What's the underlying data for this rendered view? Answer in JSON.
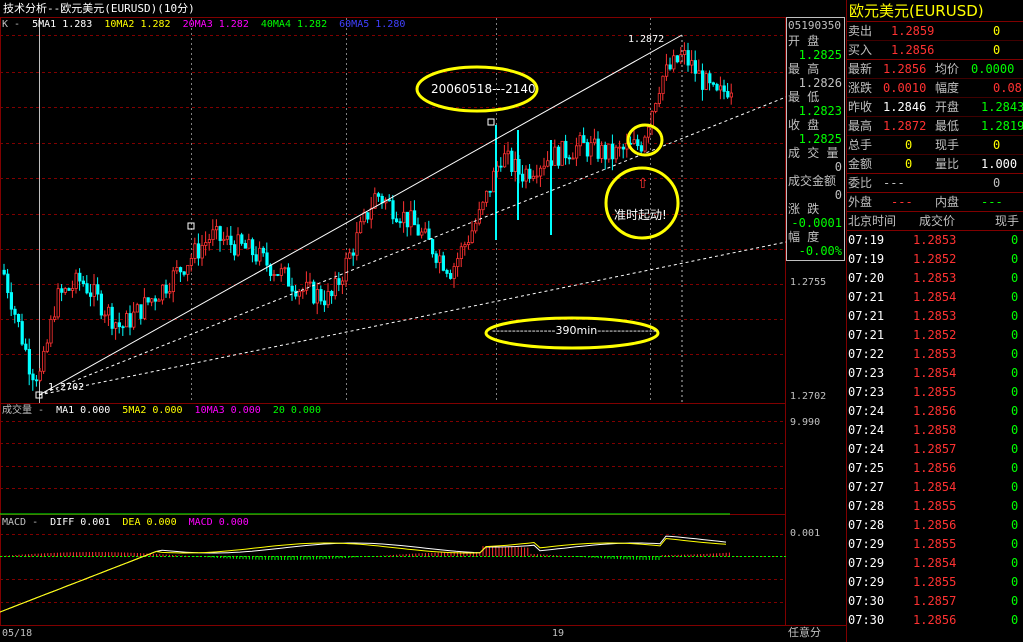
{
  "window": {
    "title": "技术分析--欧元美元(EURUSD)(10分)"
  },
  "indicators": {
    "main": {
      "prefix": "K -",
      "ma1": "5MA1  1.283",
      "ma2": "10MA2  1.282",
      "ma3": "20MA3  1.282",
      "ma4": "40MA4  1.282",
      "ma5": "60MA5  1.280"
    },
    "volume": {
      "prefix": "成交量 -",
      "ma1": "MA1  0.000",
      "ma2": "5MA2  0.000",
      "ma3": "10MA3  0.000",
      "ma4": "20  0.000"
    },
    "macd": {
      "prefix": "MACD -",
      "diff": "DIFF  0.001",
      "dea": "DEA  0.000",
      "macd": "MACD  0.000"
    }
  },
  "price_axis": {
    "p1": "1.2755",
    "p2": "1.2702",
    "vol": "9.990",
    "macd": "0.001"
  },
  "chart_labels": {
    "high": "1.2872",
    "low": "1.2702"
  },
  "time_axis": {
    "start": "05/18",
    "mid": "19",
    "mode": "任意分"
  },
  "annotations": {
    "a1": "20060518---2140",
    "a2": "----------------390min---------------",
    "a3": "准时起动!"
  },
  "crosshair_box": {
    "date": "05190350",
    "open_label": "开    盘",
    "open_value": "1.2825",
    "high_label": "最    高",
    "high_value": "1.2826",
    "low_label": "最    低",
    "low_value": "1.2823",
    "close_label": "收    盘",
    "close_value": "1.2825",
    "vol_label": "成 交 量",
    "vol_value": "0",
    "amount_label": "成交金额",
    "amount_value": "0",
    "change_label": "涨    跌",
    "change_value": "-0.0001",
    "pct_label": "幅    度",
    "pct_value": "-0.00%"
  },
  "quote": {
    "title": "欧元美元(EURUSD)",
    "sell": {
      "label": "卖出",
      "price": "1.2859",
      "vol": "0"
    },
    "buy": {
      "label": "买入",
      "price": "1.2856",
      "vol": "0"
    },
    "latest": {
      "label": "最新",
      "value": "1.2856",
      "label2": "均价",
      "value2": "0.0000"
    },
    "change": {
      "label": "涨跌",
      "value": "0.0010",
      "label2": "幅度",
      "value2": "0.08"
    },
    "prev": {
      "label": "昨收",
      "value": "1.2846",
      "label2": "开盘",
      "value2": "1.2843"
    },
    "high": {
      "label": "最高",
      "value": "1.2872",
      "label2": "最低",
      "value2": "1.2819"
    },
    "total": {
      "label": "总手",
      "value": "0",
      "label2": "现手",
      "value2": "0"
    },
    "amount": {
      "label": "金额",
      "value": "0",
      "label2": "量比",
      "value2": "1.000"
    },
    "ratio": {
      "label": "委比",
      "value": "---",
      "value2": "0"
    },
    "outer": {
      "label": "外盘",
      "value": "---",
      "label2": "内盘",
      "value2": "---"
    },
    "ticks_header": {
      "time": "北京时间",
      "price": "成交价",
      "vol": "现手"
    },
    "ticks": [
      {
        "t": "07:19",
        "p": "1.2853",
        "v": "0"
      },
      {
        "t": "07:19",
        "p": "1.2852",
        "v": "0"
      },
      {
        "t": "07:20",
        "p": "1.2853",
        "v": "0"
      },
      {
        "t": "07:21",
        "p": "1.2854",
        "v": "0"
      },
      {
        "t": "07:21",
        "p": "1.2853",
        "v": "0"
      },
      {
        "t": "07:21",
        "p": "1.2852",
        "v": "0"
      },
      {
        "t": "07:22",
        "p": "1.2853",
        "v": "0"
      },
      {
        "t": "07:23",
        "p": "1.2854",
        "v": "0"
      },
      {
        "t": "07:23",
        "p": "1.2855",
        "v": "0"
      },
      {
        "t": "07:24",
        "p": "1.2856",
        "v": "0"
      },
      {
        "t": "07:24",
        "p": "1.2858",
        "v": "0"
      },
      {
        "t": "07:24",
        "p": "1.2857",
        "v": "0"
      },
      {
        "t": "07:25",
        "p": "1.2856",
        "v": "0"
      },
      {
        "t": "07:27",
        "p": "1.2854",
        "v": "0"
      },
      {
        "t": "07:28",
        "p": "1.2855",
        "v": "0"
      },
      {
        "t": "07:28",
        "p": "1.2856",
        "v": "0"
      },
      {
        "t": "07:29",
        "p": "1.2855",
        "v": "0"
      },
      {
        "t": "07:29",
        "p": "1.2854",
        "v": "0"
      },
      {
        "t": "07:29",
        "p": "1.2855",
        "v": "0"
      },
      {
        "t": "07:30",
        "p": "1.2857",
        "v": "0"
      },
      {
        "t": "07:30",
        "p": "1.2856",
        "v": "0"
      }
    ]
  },
  "colors": {
    "up": "#ff3232",
    "down": "#00ffff",
    "grid": "#800000",
    "ma1": "#ffffff",
    "ma2": "#ffff00",
    "ma3": "#ff00ff",
    "ma4": "#00ff00",
    "ma5": "#0000ff",
    "ann": "#ffff00",
    "green": "#00ff00"
  }
}
